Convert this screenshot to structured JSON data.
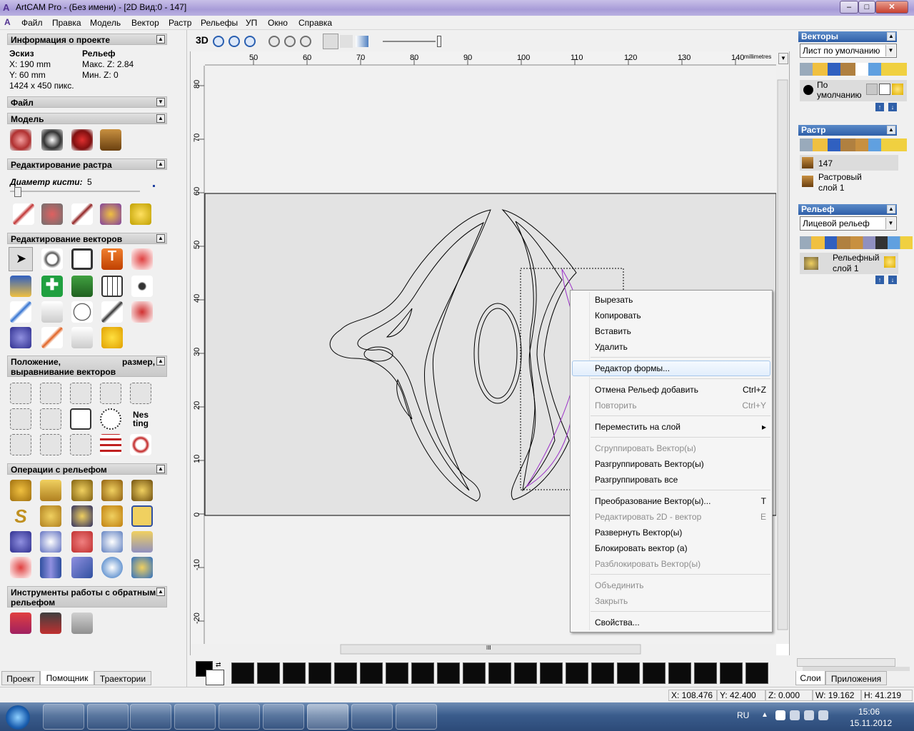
{
  "window": {
    "title": "ArtCAM Pro - (Без имени) - [2D Вид:0 - 147]",
    "app_icon": "artcam-icon",
    "min": "–",
    "max": "□",
    "close": "✕"
  },
  "menu": [
    "Файл",
    "Правка",
    "Модель",
    "Вектор",
    "Растр",
    "Рельефы",
    "УП",
    "Окно",
    "Справка"
  ],
  "left": {
    "project_info": {
      "header": "Информация о проекте",
      "sketch": "Эскиз",
      "relief": "Рельеф",
      "x": "X: 190 mm",
      "y": "Y: 60 mm",
      "px": "1424 x 450 пикс.",
      "max_z": "Макс. Z: 2.84",
      "min_z": "Мин. Z: 0"
    },
    "file": "Файл",
    "model": "Модель",
    "raster_edit": "Редактирование растра",
    "brush_label": "Диаметр кисти:",
    "brush_value": "5",
    "vector_edit": "Редактирование векторов",
    "vector_pos_a": "Положение,",
    "vector_pos_b": "размер,",
    "vector_pos_c": "выравнивание векторов",
    "relief_ops": "Операции с рельефом",
    "reverse_tools_a": "Инструменты работы с обратным",
    "reverse_tools_b": "рельефом",
    "nesting": "Nes ting",
    "tabs": [
      "Проект",
      "Помощник",
      "Траектории"
    ]
  },
  "view": {
    "label_3d": "3D",
    "units": "millimetres",
    "ruler_x": [
      "50",
      "60",
      "70",
      "80",
      "90",
      "100",
      "110",
      "120",
      "130",
      "140"
    ],
    "ruler_y": [
      "80",
      "70",
      "60",
      "50",
      "40",
      "30",
      "20",
      "10",
      "0",
      "-10",
      "-20"
    ],
    "scroll_grip": "III"
  },
  "context_menu": {
    "items": [
      {
        "label": "Вырезать",
        "shortcut": "",
        "disabled": false
      },
      {
        "label": "Копировать",
        "shortcut": "",
        "disabled": false
      },
      {
        "label": "Вставить",
        "shortcut": "",
        "disabled": false
      },
      {
        "label": "Удалить",
        "shortcut": "",
        "disabled": false
      },
      {
        "label": "Редактор формы...",
        "shortcut": "",
        "disabled": false
      },
      {
        "label": "Отмена Рельеф добавить",
        "shortcut": "Ctrl+Z",
        "disabled": false
      },
      {
        "label": "Повторить",
        "shortcut": "Ctrl+Y",
        "disabled": true
      },
      {
        "label": "Переместить на слой",
        "shortcut": "▸",
        "disabled": false
      },
      {
        "label": "Сгруппировать Вектор(ы)",
        "shortcut": "",
        "disabled": true
      },
      {
        "label": "Разгруппировать Вектор(ы)",
        "shortcut": "",
        "disabled": false
      },
      {
        "label": "Разгруппировать все",
        "shortcut": "",
        "disabled": false
      },
      {
        "label": "Преобразование Вектор(ы)...",
        "shortcut": "T",
        "disabled": false
      },
      {
        "label": "Редактировать 2D - вектор",
        "shortcut": "E",
        "disabled": true
      },
      {
        "label": "Развернуть Вектор(ы)",
        "shortcut": "",
        "disabled": false
      },
      {
        "label": "Блокировать вектор (а)",
        "shortcut": "",
        "disabled": false
      },
      {
        "label": "Разблокировать Вектор(ы)",
        "shortcut": "",
        "disabled": true
      },
      {
        "label": "Объединить",
        "shortcut": "",
        "disabled": true
      },
      {
        "label": "Закрыть",
        "shortcut": "",
        "disabled": true
      },
      {
        "label": "Свойства...",
        "shortcut": "",
        "disabled": false
      }
    ]
  },
  "right": {
    "vectors": {
      "header": "Векторы",
      "combo": "Лист по умолчанию",
      "layer": "По умолчанию"
    },
    "raster": {
      "header": "Растр",
      "item1": "147",
      "item2a": "Растровый",
      "item2b": "слой 1"
    },
    "relief": {
      "header": "Рельеф",
      "combo": "Лицевой рельеф",
      "layer_a": "Рельефный",
      "layer_b": "слой 1"
    },
    "tabs": [
      "Слои",
      "Приложения"
    ]
  },
  "status": {
    "x": "X: 108.476",
    "y": "Y: 42.400",
    "z": "Z: 0.000",
    "w": "W: 19.162",
    "h": "H: 41.219"
  },
  "taskbar": {
    "lang": "RU",
    "time": "15:06",
    "date": "15.11.2012"
  },
  "colors": {
    "selected_vector": "#9b30c8",
    "relief_band": "#e3e3e3",
    "panel_header": "#2f5fa8"
  }
}
